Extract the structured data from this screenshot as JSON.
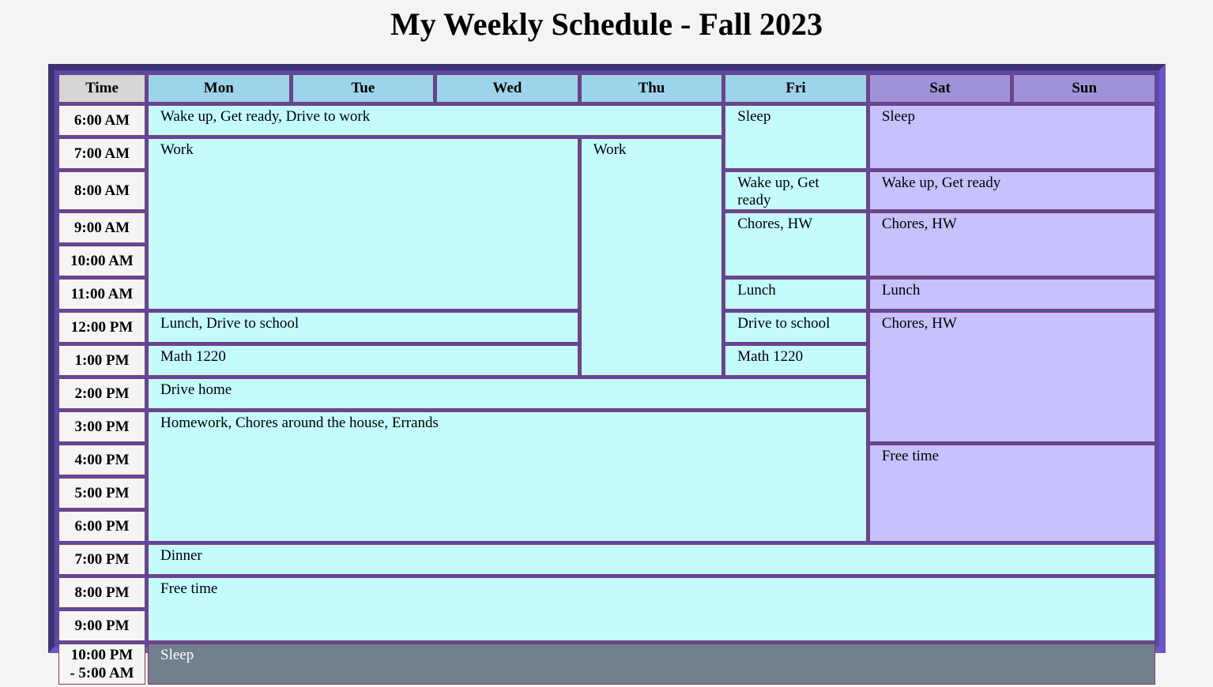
{
  "page": {
    "title": "My Weekly Schedule - Fall 2023"
  },
  "headers": {
    "time": "Time",
    "days": [
      "Mon",
      "Tue",
      "Wed",
      "Thu",
      "Fri",
      "Sat",
      "Sun"
    ]
  },
  "times": [
    "6:00 AM",
    "7:00 AM",
    "8:00 AM",
    "9:00 AM",
    "10:00 AM",
    "11:00 AM",
    "12:00 PM",
    "1:00 PM",
    "2:00 PM",
    "3:00 PM",
    "4:00 PM",
    "5:00 PM",
    "6:00 PM",
    "7:00 PM",
    "8:00 PM",
    "9:00 PM"
  ],
  "last_time": {
    "line1": "10:00 PM",
    "line2": "- 5:00 AM"
  },
  "events": {
    "wake_work": "Wake up, Get ready, Drive to work",
    "fri_sleep": "Sleep",
    "we_sleep": "Sleep",
    "work_mw": "Work",
    "work_thu": "Work",
    "fri_wake": "Wake up, Get ready",
    "we_wake": "Wake up, Get ready",
    "fri_chores": "Chores, HW",
    "we_chores": "Chores, HW",
    "fri_lunch": "Lunch",
    "we_lunch": "Lunch",
    "lunch_school": "Lunch, Drive to school",
    "fri_drive": "Drive to school",
    "we_chores2": "Chores, HW",
    "math_mw": "Math 1220",
    "fri_math": "Math 1220",
    "drive_home": "Drive home",
    "homework": "Homework, Chores around the house, Errands",
    "we_free": "Free time",
    "dinner": "Dinner",
    "free_time": "Free time",
    "sleep": "Sleep"
  },
  "colors": {
    "weekday_header": "#9ed3ec",
    "weekend_header": "#a092d8",
    "weekday_cell": "#c4fbfd",
    "weekend_cell": "#c7c1fd",
    "sleep_cell": "#717f8f",
    "frame": "#574aa8"
  }
}
